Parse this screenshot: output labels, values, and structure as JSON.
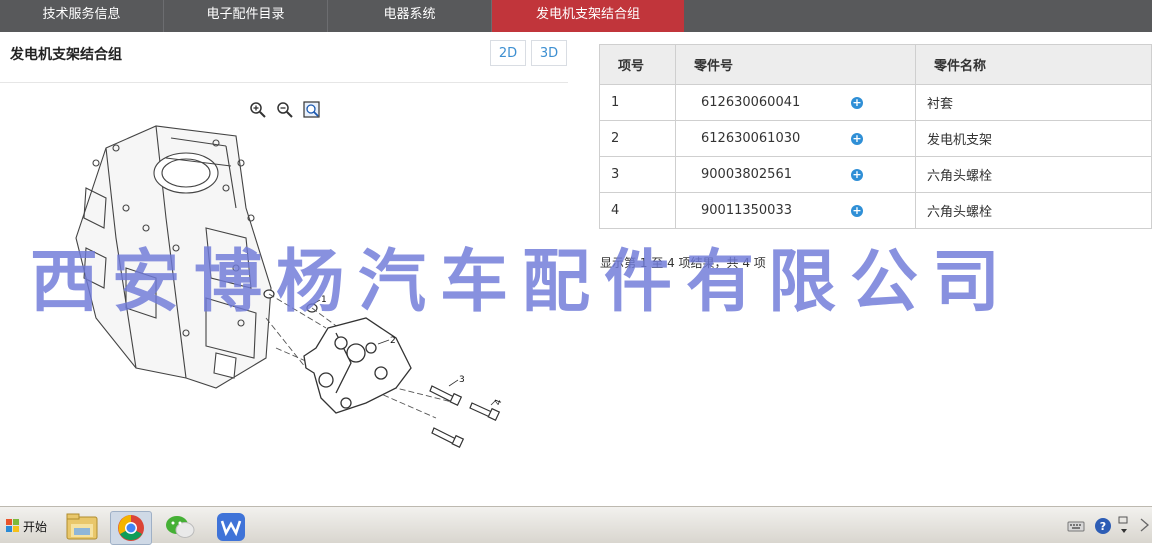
{
  "tabs": [
    "技术服务信息",
    "电子配件目录",
    "电器系统",
    "发电机支架结合组"
  ],
  "left": {
    "title": "发电机支架结合组",
    "view_2d": "2D",
    "view_3d": "3D"
  },
  "diagram": {
    "callouts": [
      "1",
      "2",
      "3",
      "4"
    ]
  },
  "table": {
    "headers": [
      "项号",
      "零件号",
      "零件名称"
    ],
    "rows": [
      {
        "no": "1",
        "part": "612630060041",
        "name": "衬套"
      },
      {
        "no": "2",
        "part": "612630061030",
        "name": "发电机支架"
      },
      {
        "no": "3",
        "part": "90003802561",
        "name": "六角头螺栓"
      },
      {
        "no": "4",
        "part": "90011350033",
        "name": "六角头螺栓"
      }
    ]
  },
  "result_info": "显示第 1 至 4 项结果，共 4 项",
  "watermark": "西安博杨汽车配件有限公司",
  "taskbar": {
    "start": "开始"
  },
  "colors": {
    "tabbar": "#58595b",
    "active_tab": "#c1353b",
    "accent_blue": "#3d8fd1",
    "watermark": "#6f7ad8"
  },
  "icons": [
    "zoom-in-icon",
    "zoom-out-icon",
    "zoom-fit-icon",
    "add-icon",
    "folder-icon",
    "chrome-icon",
    "wechat-icon",
    "wps-icon",
    "keyboard-icon",
    "help-icon",
    "arrow-icon"
  ]
}
